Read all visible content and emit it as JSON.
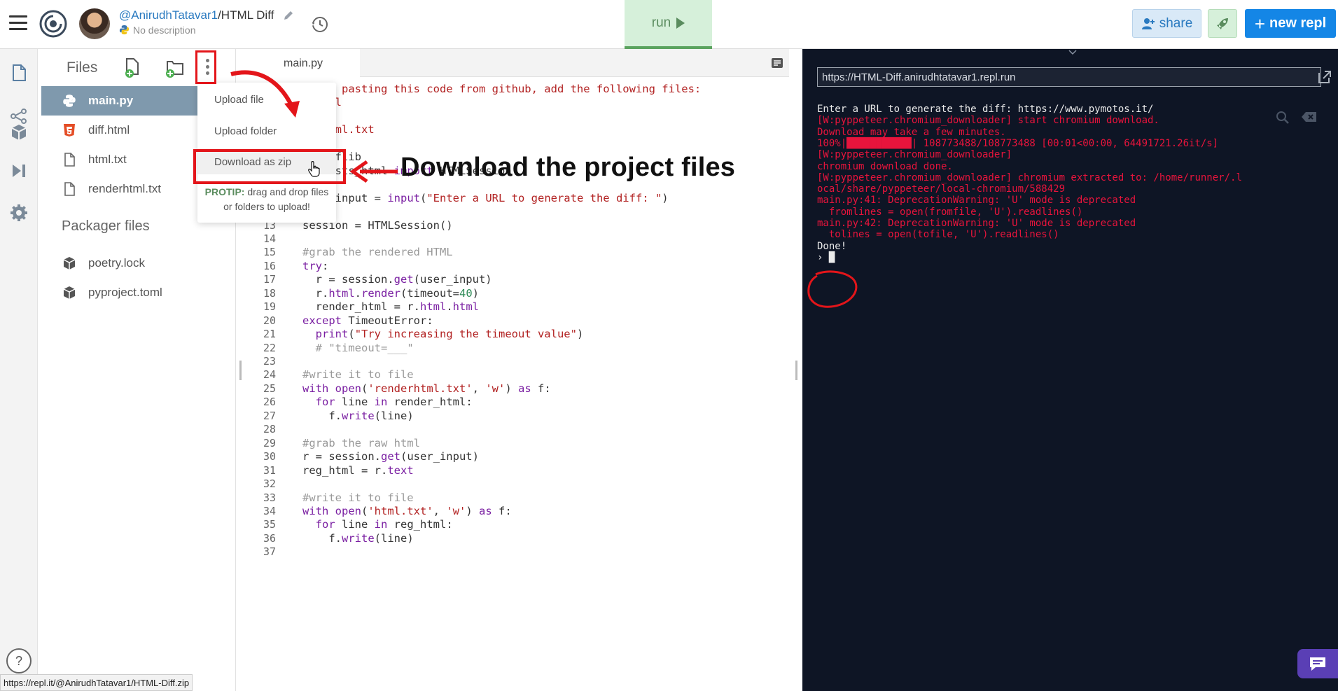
{
  "header": {
    "owner": "@AnirudhTatavar1",
    "repl_name": "/HTML Diff",
    "description": "No description",
    "run_label": "run",
    "share_label": "share",
    "new_repl_label": "new repl"
  },
  "files_panel": {
    "title": "Files",
    "files": [
      {
        "name": "main.py",
        "icon": "python-icon",
        "active": true
      },
      {
        "name": "diff.html",
        "icon": "html5-icon",
        "active": false
      },
      {
        "name": "html.txt",
        "icon": "file-icon",
        "active": false
      },
      {
        "name": "renderhtml.txt",
        "icon": "file-icon",
        "active": false
      }
    ],
    "packager_title": "Packager files",
    "packager_files": [
      {
        "name": "poetry.lock",
        "icon": "package-icon"
      },
      {
        "name": "pyproject.toml",
        "icon": "package-icon"
      }
    ]
  },
  "menu": {
    "items": [
      "Upload file",
      "Upload folder",
      "Download as zip"
    ],
    "protip_label": "PROTIP:",
    "protip_text": "drag and drop files or folders to upload!"
  },
  "editor": {
    "tab": "main.py",
    "lines": [
      {
        "n": "",
        "html": "<span class=\"c-red\">u are pasting this code from github, add the following files:</span>"
      },
      {
        "n": "",
        "html": "<span class=\"c-red\">f.html</span>"
      },
      {
        "n": "",
        "html": "<span class=\"c-red\">l.txt</span>"
      },
      {
        "n": "",
        "html": "<span class=\"c-red\">derhtml.txt</span>"
      },
      {
        "n": "",
        "html": ""
      },
      {
        "n": "",
        "html": "<span class=\"c-kwb\">t</span> difflib"
      },
      {
        "n": "",
        "html": "requests_html <span class=\"c-kwb\">import</span> HTMLSession"
      },
      {
        "n": "10",
        "html": ""
      },
      {
        "n": "11",
        "html": "user_input = <span class=\"c-func\">input</span>(<span class=\"c-red\">\"Enter a URL to generate the diff: \"</span>)"
      },
      {
        "n": "12",
        "html": ""
      },
      {
        "n": "13",
        "html": "session = HTMLSession()"
      },
      {
        "n": "14",
        "html": ""
      },
      {
        "n": "15",
        "html": "<span class=\"c-com\">#grab the rendered HTML</span>"
      },
      {
        "n": "16",
        "html": "<span class=\"c-kwb\">try</span>:"
      },
      {
        "n": "17",
        "html": "  r = session.<span class=\"c-func\">get</span>(user_input)"
      },
      {
        "n": "18",
        "html": "  r.<span class=\"c-func\">html</span>.<span class=\"c-func\">render</span>(timeout=<span class=\"c-num\">40</span>)"
      },
      {
        "n": "19",
        "html": "  render_html = r.<span class=\"c-func\">html</span>.<span class=\"c-func\">html</span>"
      },
      {
        "n": "20",
        "html": "<span class=\"c-kwb\">except</span> TimeoutError:"
      },
      {
        "n": "21",
        "html": "  <span class=\"c-func\">print</span>(<span class=\"c-red\">\"Try increasing the timeout value\"</span>)"
      },
      {
        "n": "22",
        "html": "  <span class=\"c-com\"># \"timeout=___\"</span>"
      },
      {
        "n": "23",
        "html": ""
      },
      {
        "n": "24",
        "html": "<span class=\"c-com\">#write it to file</span>"
      },
      {
        "n": "25",
        "html": "<span class=\"c-kwb\">with</span> <span class=\"c-func\">open</span>(<span class=\"c-red\">'renderhtml.txt'</span>, <span class=\"c-red\">'w'</span>) <span class=\"c-kwb\">as</span> f:"
      },
      {
        "n": "26",
        "html": "  <span class=\"c-kwb\">for</span> line <span class=\"c-kwb\">in</span> render_html:"
      },
      {
        "n": "27",
        "html": "    f.<span class=\"c-func\">write</span>(line)"
      },
      {
        "n": "28",
        "html": ""
      },
      {
        "n": "29",
        "html": "<span class=\"c-com\">#grab the raw html</span>"
      },
      {
        "n": "30",
        "html": "r = session.<span class=\"c-func\">get</span>(user_input)"
      },
      {
        "n": "31",
        "html": "reg_html = r.<span class=\"c-func\">text</span>"
      },
      {
        "n": "32",
        "html": ""
      },
      {
        "n": "33",
        "html": "<span class=\"c-com\">#write it to file</span>"
      },
      {
        "n": "34",
        "html": "<span class=\"c-kwb\">with</span> <span class=\"c-func\">open</span>(<span class=\"c-red\">'html.txt'</span>, <span class=\"c-red\">'w'</span>) <span class=\"c-kwb\">as</span> f:"
      },
      {
        "n": "35",
        "html": "  <span class=\"c-kwb\">for</span> line <span class=\"c-kwb\">in</span> reg_html:"
      },
      {
        "n": "36",
        "html": "    f.<span class=\"c-func\">write</span>(line)"
      },
      {
        "n": "37",
        "html": ""
      }
    ]
  },
  "console": {
    "url": "https://HTML-Diff.anirudhtatavar1.repl.run",
    "lines": [
      {
        "text": "Enter a URL to generate the diff: https://www.pymotos.it/",
        "color": "white"
      },
      {
        "text": "[W:pyppeteer.chromium_downloader] start chromium download.",
        "color": "red"
      },
      {
        "text": "Download may take a few minutes.",
        "color": "red"
      },
      {
        "text": "100%|███████████| 108773488/108773488 [00:01<00:00, 64491721.26it/s]",
        "color": "red"
      },
      {
        "text": "[W:pyppeteer.chromium_downloader]",
        "color": "red"
      },
      {
        "text": "chromium download done.",
        "color": "red"
      },
      {
        "text": "[W:pyppeteer.chromium_downloader] chromium extracted to: /home/runner/.l",
        "color": "red"
      },
      {
        "text": "ocal/share/pyppeteer/local-chromium/588429",
        "color": "red"
      },
      {
        "text": "main.py:41: DeprecationWarning: 'U' mode is deprecated",
        "color": "red"
      },
      {
        "text": "  fromlines = open(fromfile, 'U').readlines()",
        "color": "red"
      },
      {
        "text": "main.py:42: DeprecationWarning: 'U' mode is deprecated",
        "color": "red"
      },
      {
        "text": "  tolines = open(tofile, 'U').readlines()",
        "color": "red"
      },
      {
        "text": "Done!",
        "color": "white"
      },
      {
        "text": "› █",
        "color": "white"
      }
    ]
  },
  "annotation": {
    "text": "Download the project files"
  },
  "status_bar": {
    "url": "https://repl.it/@AnirudhTatavar1/HTML-Diff.zip"
  },
  "colors": {
    "accent_blue": "#1486e6",
    "run_green": "#5ba35f",
    "active_file": "#7f99ad",
    "console_bg": "#0e1525",
    "console_red": "#e8143c",
    "annotation_red": "#e3151a"
  }
}
